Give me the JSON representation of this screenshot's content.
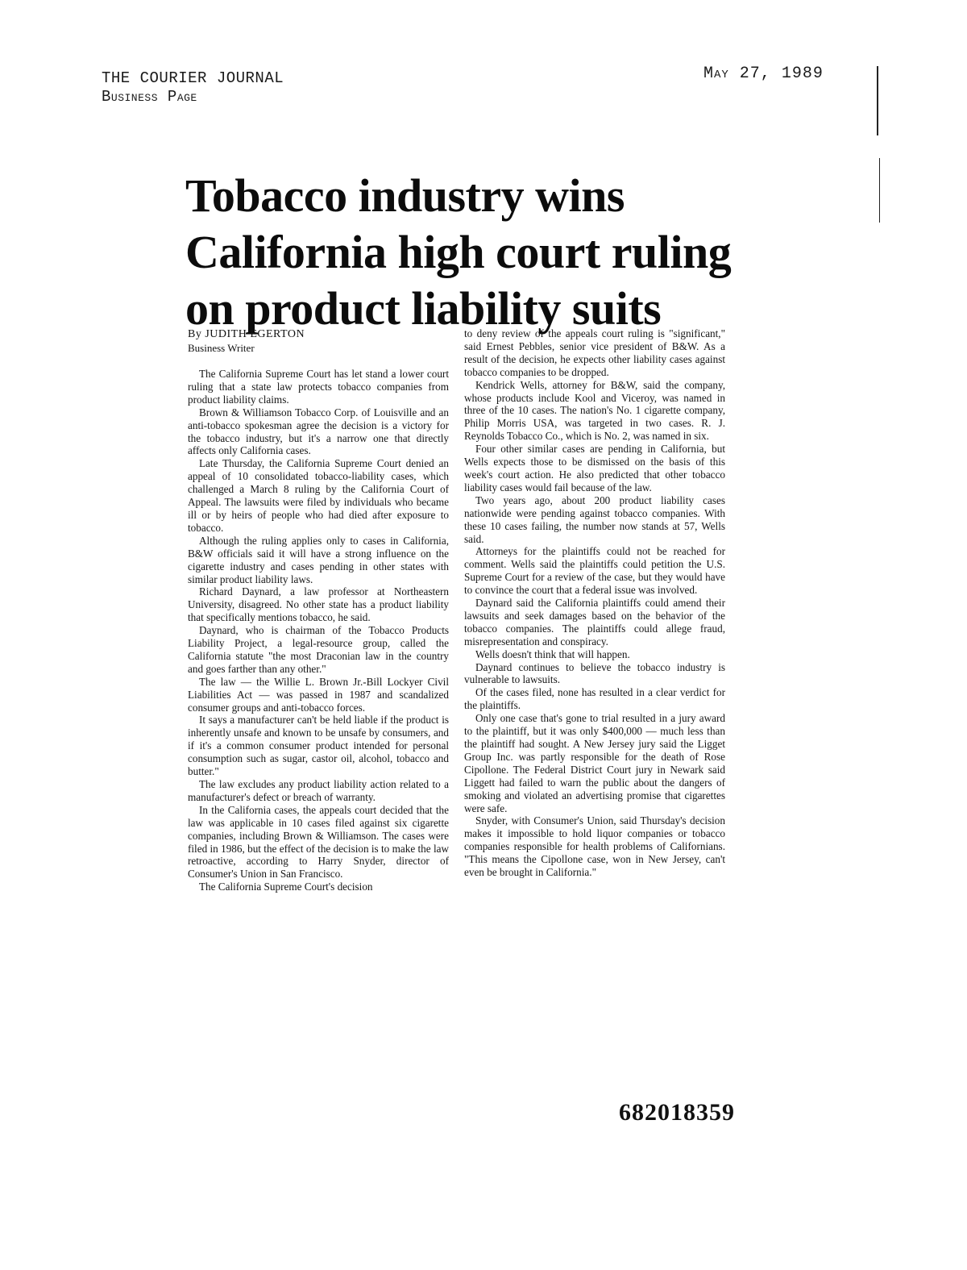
{
  "header": {
    "publication": "THE COURIER JOURNAL",
    "section": "Business Page",
    "date": "May 27, 1989"
  },
  "article": {
    "headline": [
      "Tobacco industry wins",
      "California high court ruling",
      "on product liability suits"
    ],
    "byline": "By JUDITH EGERTON",
    "byline_title": "Business Writer",
    "left_column": [
      "The California Supreme Court has let stand a lower court ruling that a state law protects tobacco companies from product liability claims.",
      "Brown & Williamson Tobacco Corp. of Louisville and an anti-tobacco spokesman agree the decision is a victory for the tobacco industry, but it's a narrow one that directly affects only California cases.",
      "Late Thursday, the California Supreme Court denied an appeal of 10 consolidated tobacco-liability cases, which challenged a March 8 ruling by the California Court of Appeal. The lawsuits were filed by individuals who became ill or by heirs of people who had died after exposure to tobacco.",
      "Although the ruling applies only to cases in California, B&W officials said it will have a strong influence on the cigarette industry and cases pending in other states with similar product liability laws.",
      "Richard Daynard, a law professor at Northeastern University, disagreed. No other state has a product liability that specifically mentions tobacco, he said.",
      "Daynard, who is chairman of the Tobacco Products Liability Project, a legal-resource group, called the California statute \"the most Draconian law in the country and goes farther than any other.\"",
      "The law — the Willie L. Brown Jr.-Bill Lockyer Civil Liabilities Act — was passed in 1987 and scandalized consumer groups and anti-tobacco forces.",
      "It says a manufacturer can't be held liable if the product is inherently unsafe and known to be unsafe by consumers, and if it's a common consumer product intended for personal consumption such as sugar, castor oil, alcohol, tobacco and butter.\"",
      "The law excludes any product liability action related to a manufacturer's defect or breach of warranty.",
      "In the California cases, the appeals court decided that the law was applicable in 10 cases filed against six cigarette companies, including Brown & Williamson. The cases were filed in 1986, but the effect of the decision is to make the law retroactive, according to Harry Snyder, director of Consumer's Union in San Francisco.",
      "The California Supreme Court's decision"
    ],
    "right_column": [
      "to deny review of the appeals court ruling is \"significant,\" said Ernest Pebbles, senior vice president of B&W. As a result of the decision, he expects other liability cases against tobacco companies to be dropped.",
      "Kendrick Wells, attorney for B&W, said the company, whose products include Kool and Viceroy, was named in three of the 10 cases. The nation's No. 1 cigarette company, Philip Morris USA, was targeted in two cases. R. J. Reynolds Tobacco Co., which is No. 2, was named in six.",
      "Four other similar cases are pending in California, but Wells expects those to be dismissed on the basis of this week's court action. He also predicted that other tobacco liability cases would fail because of the law.",
      "Two years ago, about 200 product liability cases nationwide were pending against tobacco companies. With these 10 cases failing, the number now stands at 57, Wells said.",
      "Attorneys for the plaintiffs could not be reached for comment. Wells said the plaintiffs could petition the U.S. Supreme Court for a review of the case, but they would have to convince the court that a federal issue was involved.",
      "Daynard said the California plaintiffs could amend their lawsuits and seek damages based on the behavior of the tobacco companies. The plaintiffs could allege fraud, misrepresentation and conspiracy.",
      "Wells doesn't think that will happen.",
      "Daynard continues to believe the tobacco industry is vulnerable to lawsuits.",
      "Of the cases filed, none has resulted in a clear verdict for the plaintiffs.",
      "Only one case that's gone to trial resulted in a jury award to the plaintiff, but it was only $400,000 — much less than the plaintiff had sought. A New Jersey jury said the Ligget Group Inc. was partly responsible for the death of Rose Cipollone. The Federal District Court jury in Newark said Liggett had failed to warn the public about the dangers of smoking and violated an advertising promise that cigarettes were safe.",
      "Snyder, with Consumer's Union, said Thursday's decision makes it impossible to hold liquor companies or tobacco companies responsible for health problems of Californians. \"This means the Cipollone case, won in New Jersey, can't even be brought in California.\""
    ]
  },
  "document_id": "682018359"
}
